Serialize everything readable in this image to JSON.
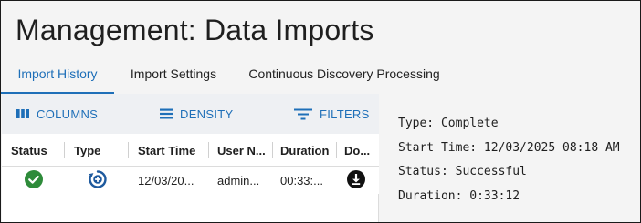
{
  "page": {
    "title": "Management: Data Imports"
  },
  "tabs": [
    {
      "label": "Import History",
      "active": true
    },
    {
      "label": "Import Settings",
      "active": false
    },
    {
      "label": "Continuous Discovery Processing",
      "active": false
    }
  ],
  "toolbar": {
    "columns_label": "COLUMNS",
    "density_label": "DENSITY",
    "filters_label": "FILTERS"
  },
  "grid": {
    "columns": [
      "Status",
      "Type",
      "Start Time",
      "User N...",
      "Duration",
      "Do..."
    ],
    "rows": [
      {
        "status_icon": "check-circle-icon",
        "type_icon": "import-type-icon",
        "start_time": "12/03/20...",
        "user": "admin...",
        "duration": "00:33:...",
        "download_icon": "download-icon"
      }
    ]
  },
  "details": {
    "type": "Type: Complete",
    "start_time": "Start Time: 12/03/2025 08:18 AM",
    "status": "Status: Successful",
    "duration": "Duration: 0:33:12"
  },
  "colors": {
    "accent": "#1e6fb8",
    "success": "#2e8b3a",
    "toolbar_bg": "#eef0f3"
  }
}
